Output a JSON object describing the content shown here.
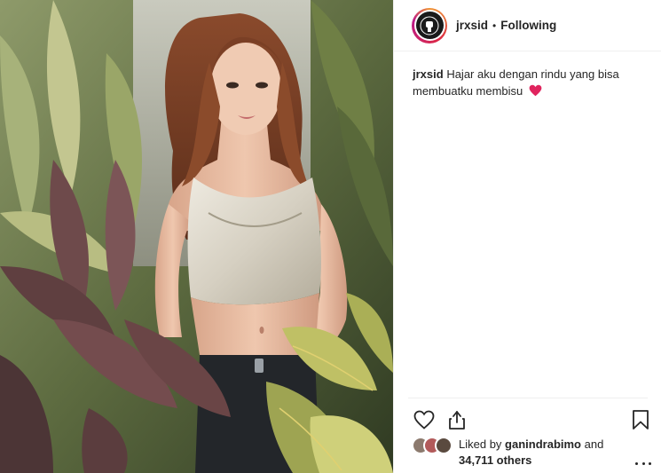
{
  "header": {
    "username": "jrxsid",
    "separator": "•",
    "follow_status": "Following"
  },
  "caption": {
    "username": "jrxsid",
    "text": "Hajar aku dengan rindu yang bisa membuatku membisu",
    "emoji": "red-heart"
  },
  "actions": {
    "like_icon": "heart-outline-icon",
    "share_icon": "share-icon",
    "save_icon": "bookmark-icon"
  },
  "likes": {
    "prefix": "Liked by",
    "liker": "ganindrabimo",
    "conjunction": "and",
    "others": "34,711 others"
  },
  "colors": {
    "text": "#262626",
    "heart_emoji": "#e0245e",
    "divider": "#efefef"
  }
}
